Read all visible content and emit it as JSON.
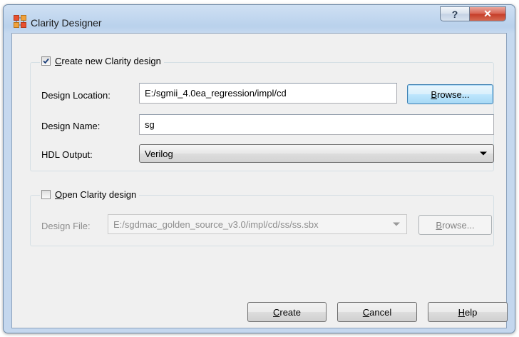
{
  "window": {
    "title": "Clarity Designer",
    "help_glyph": "?",
    "close_glyph": "✕"
  },
  "create_group": {
    "checkbox_label_accel": "C",
    "checkbox_label_rest": "reate new Clarity design",
    "checked": true,
    "design_location_label": "Design Location:",
    "design_location_value": "E:/sgmii_4.0ea_regression/impl/cd",
    "browse_accel": "B",
    "browse_rest": "rowse...",
    "design_name_label": "Design Name:",
    "design_name_value": "sg",
    "hdl_output_label": "HDL Output:",
    "hdl_output_value": "Verilog"
  },
  "open_group": {
    "checkbox_label_accel": "O",
    "checkbox_label_rest": "pen Clarity design",
    "checked": false,
    "design_file_label": "Design File:",
    "design_file_value": "E:/sgdmac_golden_source_v3.0/impl/cd/ss/ss.sbx",
    "browse_accel": "B",
    "browse_rest": "rowse..."
  },
  "footer": {
    "create_accel": "C",
    "create_rest": "reate",
    "cancel_accel": "C",
    "cancel_rest": "ancel",
    "help_accel": "H",
    "help_rest": "elp"
  },
  "colors": {
    "title_bar": "#c4d7ee",
    "close_button": "#c94a36",
    "focus_button": "#bee6fd",
    "dialog_face": "#f0f0f0"
  }
}
